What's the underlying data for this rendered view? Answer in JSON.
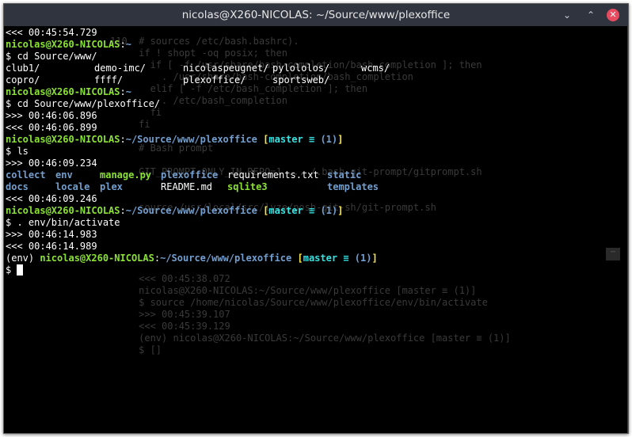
{
  "window": {
    "title": "nicolas@X260-NICOLAS: ~/Source/www/plexoffice",
    "minimize": "⌄",
    "maximize": "⌃",
    "close": "✕"
  },
  "ghost_lines": [
    "110  # sources /etc/bash.bashrc).",
    "     if ! shopt -oq posix; then",
    "       if [ -f /usr/share/bash-completion/bash_completion ]; then",
    "         . /usr/share/bash-completion/bash_completion",
    "       elif [ -f /etc/bash_completion ]; then",
    "         . /etc/bash_completion",
    "       fi",
    "     fi",
    "",
    "     # Bash prompt",
    "",
    "     GIT_PROMPT_ONLY_IN_REPO=1 ... /.bash-git-prompt/gitprompt.sh",
    "",
    "",
    "     source /usr/local/src/lyze/posh-git-sh/git-prompt.sh",
    "",
    "",
    "",
    "",
    "",
    "     <<< 00:45:38.072",
    "     nicolas@X260-NICOLAS:~/Source/www/plexoffice [master ≡ (1)]",
    "     $ source /home/nicolas/Source/www/plexoffice/env/bin/activate",
    "     >>> 00:45:39.107",
    "     <<< 00:45:39.129",
    "     (env) nicolas@X260-NICOLAS:~/Source/www/plexoffice [master ≡ (1)]",
    "     $ []"
  ],
  "terminal": {
    "l1": "<<< 00:45:54.729",
    "user_host": "nicolas@X260-NICOLAS",
    "colon": ":",
    "home": "~",
    "cmd_cd1": "$ cd Source/www/",
    "dir_row1": [
      "club1/",
      "demo-imc/",
      "nicolaspeugnet/",
      "pylololos/",
      "wcms/"
    ],
    "dir_row2": [
      "copro/",
      "ffff/",
      "plexoffice/",
      "sportsweb/"
    ],
    "cmd_cd2": "$ cd Source/www/plexoffice/",
    "t1": ">>> 00:46:06.896",
    "t2": "<<< 00:46:06.899",
    "path": "~/Source/www/plexoffice",
    "space": " ",
    "branch_open": "[",
    "branch": "master",
    "branch_sym": "≡",
    "branch_count": "(1)",
    "branch_close": "]",
    "cmd_ls": "$ ls",
    "t3": ">>> 00:46:09.234",
    "ls_row1": [
      {
        "text": "collect",
        "kind": "dir"
      },
      {
        "text": "env",
        "kind": "dir"
      },
      {
        "text": "manage.py",
        "kind": "exec"
      },
      {
        "text": "plexoffice",
        "kind": "dir"
      },
      {
        "text": "requirements.txt",
        "kind": "file"
      },
      {
        "text": "static",
        "kind": "dir"
      }
    ],
    "ls_row2": [
      {
        "text": "docs",
        "kind": "dir"
      },
      {
        "text": "locale",
        "kind": "dir"
      },
      {
        "text": "plex",
        "kind": "dir"
      },
      {
        "text": "README.md",
        "kind": "file"
      },
      {
        "text": "sqlite3",
        "kind": "exec"
      },
      {
        "text": "templates",
        "kind": "dir"
      }
    ],
    "t4": "<<< 00:46:09.246",
    "cmd_activate": "$ . env/bin/activate",
    "t5": ">>> 00:46:14.983",
    "t6": "<<< 00:46:14.989",
    "env": "(env) ",
    "prompt": "$ "
  },
  "colors": {
    "user_host": "#8ae234",
    "path": "#729fcf",
    "branch": "#34e2e2",
    "branch_brackets": "#fce94f",
    "titlebar": "#2f343f",
    "close_button": "#e84a5f"
  }
}
